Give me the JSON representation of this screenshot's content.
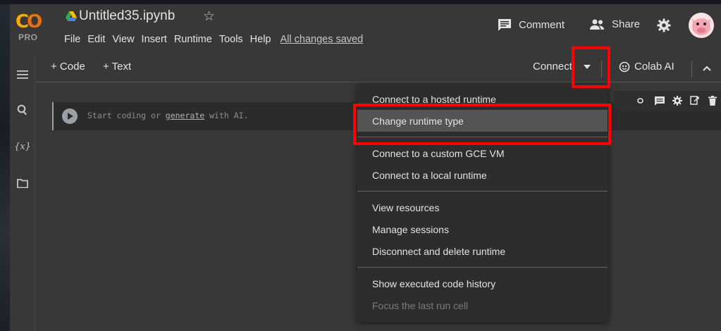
{
  "header": {
    "logo_text": "CO",
    "logo_badge": "PRO",
    "notebook_title": "Untitled35.ipynb",
    "menu": [
      "File",
      "Edit",
      "View",
      "Insert",
      "Runtime",
      "Tools",
      "Help"
    ],
    "save_status": "All changes saved",
    "comment_label": "Comment",
    "share_label": "Share"
  },
  "toolbar": {
    "add_code": "+ Code",
    "add_text": "+ Text",
    "connect_label": "Connect",
    "colab_ai_label": "Colab AI"
  },
  "cell": {
    "placeholder_start": "Start coding or ",
    "placeholder_link": "generate",
    "placeholder_end": " with AI."
  },
  "runtime_menu": {
    "groups": [
      [
        "Connect to a hosted runtime",
        "Change runtime type"
      ],
      [
        "Connect to a custom GCE VM",
        "Connect to a local runtime"
      ],
      [
        "View resources",
        "Manage sessions",
        "Disconnect and delete runtime"
      ],
      [
        "Show executed code history",
        "Focus the last run cell"
      ]
    ],
    "highlighted_item": "Change runtime type",
    "disabled_item": "Focus the last run cell"
  },
  "colors": {
    "highlight_box": "#ff0000",
    "logo_orange": "#f9ab00",
    "background": "#383838",
    "menu_bg": "#2d2d2d"
  },
  "icons": {
    "sidebar": [
      "table-of-contents-icon",
      "search-icon",
      "variables-icon",
      "files-icon"
    ],
    "cell_toolbar": [
      "link-icon",
      "comment-icon",
      "settings-icon",
      "mirror-cell-icon",
      "delete-icon",
      "more-icon"
    ]
  }
}
